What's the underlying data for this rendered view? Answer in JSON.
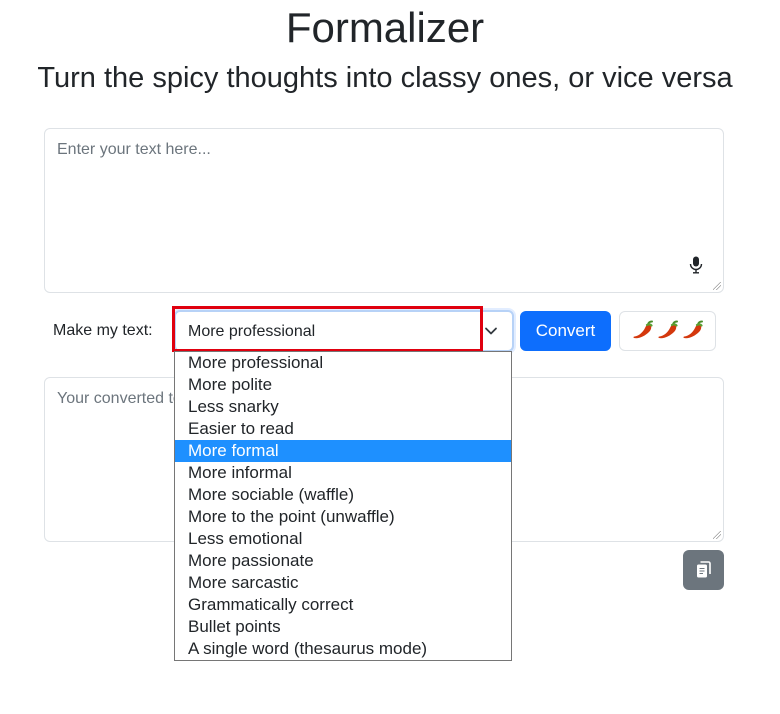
{
  "header": {
    "title": "Formalizer",
    "subtitle": "Turn the spicy thoughts into classy ones, or vice versa"
  },
  "input": {
    "placeholder": "Enter your text here...",
    "mic_icon": "microphone-icon"
  },
  "controls": {
    "make_label": "Make my text:",
    "selected_value": "More professional",
    "convert_label": "Convert",
    "spicy_icon": "chili-pepper-icon",
    "spicy_count": 3
  },
  "dropdown": {
    "highlighted": "More formal",
    "options": [
      "More professional",
      "More polite",
      "Less snarky",
      "Easier to read",
      "More formal",
      "More informal",
      "More sociable (waffle)",
      "More to the point (unwaffle)",
      "Less emotional",
      "More passionate",
      "More sarcastic",
      "Grammatically correct",
      "Bullet points",
      "A single word (thesaurus mode)"
    ]
  },
  "output": {
    "placeholder": "Your converted text will appear here...",
    "copy_icon": "copy-icon"
  },
  "colors": {
    "primary": "#0d6efd",
    "secondary": "#6c757d",
    "highlight": "#1e90ff",
    "annotation_box": "#e0000f",
    "pepper": "#d4380d"
  }
}
